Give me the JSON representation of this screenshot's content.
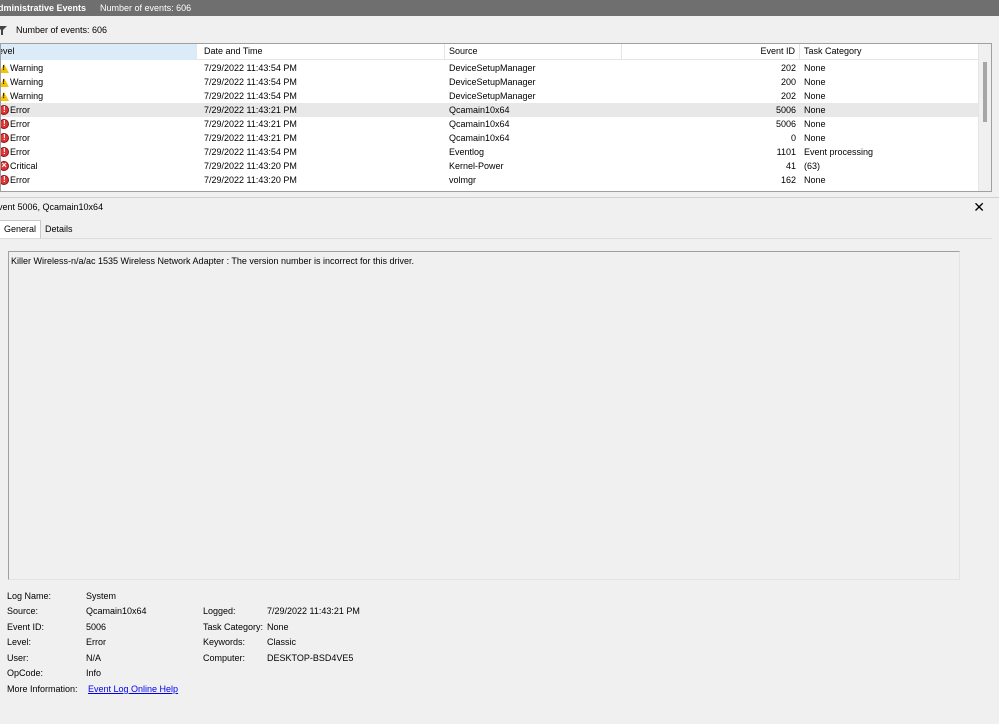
{
  "header": {
    "title": "dministrative Events",
    "count_label": "Number of events: 606"
  },
  "filter": {
    "label": "Number of events: 606",
    "icon": "filter-icon"
  },
  "grid": {
    "columns": [
      "evel",
      "Date and Time",
      "Source",
      "Event ID",
      "Task Category"
    ],
    "rows": [
      {
        "level": "Warning",
        "icon": "warning-icon",
        "date": "7/29/2022 11:43:54 PM",
        "source": "DeviceSetupManager",
        "event_id": "202",
        "task": "None"
      },
      {
        "level": "Warning",
        "icon": "warning-icon",
        "date": "7/29/2022 11:43:54 PM",
        "source": "DeviceSetupManager",
        "event_id": "200",
        "task": "None"
      },
      {
        "level": "Warning",
        "icon": "warning-icon",
        "date": "7/29/2022 11:43:54 PM",
        "source": "DeviceSetupManager",
        "event_id": "202",
        "task": "None"
      },
      {
        "level": "Error",
        "icon": "error-icon",
        "date": "7/29/2022 11:43:21 PM",
        "source": "Qcamain10x64",
        "event_id": "5006",
        "task": "None",
        "selected": true
      },
      {
        "level": "Error",
        "icon": "error-icon",
        "date": "7/29/2022 11:43:21 PM",
        "source": "Qcamain10x64",
        "event_id": "5006",
        "task": "None"
      },
      {
        "level": "Error",
        "icon": "error-icon",
        "date": "7/29/2022 11:43:21 PM",
        "source": "Qcamain10x64",
        "event_id": "0",
        "task": "None"
      },
      {
        "level": "Error",
        "icon": "error-icon",
        "date": "7/29/2022 11:43:54 PM",
        "source": "Eventlog",
        "event_id": "1101",
        "task": "Event processing"
      },
      {
        "level": "Critical",
        "icon": "critical-icon",
        "date": "7/29/2022 11:43:20 PM",
        "source": "Kernel-Power",
        "event_id": "41",
        "task": "(63)"
      },
      {
        "level": "Error",
        "icon": "error-icon",
        "date": "7/29/2022 11:43:20 PM",
        "source": "volmgr",
        "event_id": "162",
        "task": "None"
      }
    ]
  },
  "detail": {
    "title": "vent 5006, Qcamain10x64",
    "close_icon": "close-icon",
    "tabs": [
      "General",
      "Details"
    ],
    "message": "Killer Wireless-n/a/ac 1535 Wireless Network Adapter : The version number is incorrect for this driver.",
    "properties": {
      "log_name_label": "Log Name:",
      "log_name": "System",
      "source_label": "Source:",
      "source": "Qcamain10x64",
      "logged_label": "Logged:",
      "logged": "7/29/2022 11:43:21 PM",
      "event_id_label": "Event ID:",
      "event_id": "5006",
      "task_category_label": "Task Category:",
      "task_category": "None",
      "level_label": "Level:",
      "level": "Error",
      "keywords_label": "Keywords:",
      "keywords": "Classic",
      "user_label": "User:",
      "user": "N/A",
      "computer_label": "Computer:",
      "computer": "DESKTOP-BSD4VE5",
      "opcode_label": "OpCode:",
      "opcode": "Info",
      "more_info_label": "More Information:",
      "more_info_link": "Event Log Online Help"
    }
  }
}
